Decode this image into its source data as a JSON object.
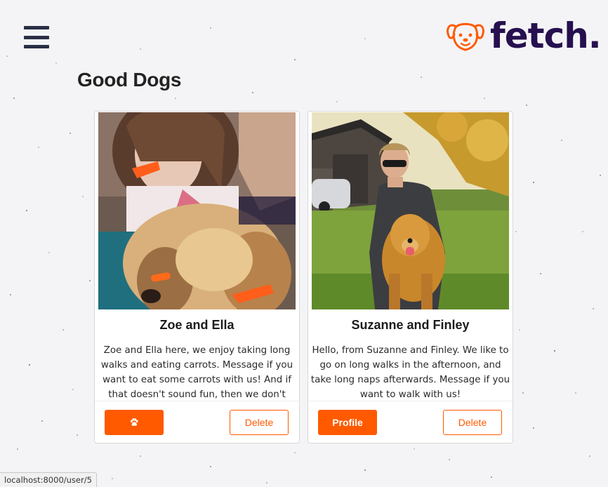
{
  "nav": {
    "menu_icon": "hamburger-menu-icon",
    "logo_icon": "dog-face-icon",
    "logo_text": "fetch."
  },
  "page": {
    "title": "Good Dogs"
  },
  "cards": [
    {
      "name": "Zoe and Ella",
      "description": "Zoe and Ella here, we enjoy taking long walks and eating carrots. Message if you want to eat some carrots with us! And if that doesn't sound fun, then we don't carrot all",
      "primary_button": {
        "label": "",
        "icon": "paw-icon"
      },
      "secondary_button": {
        "label": "Delete"
      }
    },
    {
      "name": "Suzanne and Finley",
      "description": "Hello, from Suzanne and Finley. We like to go on long walks in the afternoon, and take long naps afterwards. Message if you want to walk with us!",
      "primary_button": {
        "label": "Profile"
      },
      "secondary_button": {
        "label": "Delete"
      }
    }
  ],
  "status_bar": {
    "url": "localhost:8000/user/5"
  },
  "colors": {
    "accent": "#ff5a00",
    "brand": "#26104f",
    "menu": "#2b2f45",
    "background": "#f4f4f6"
  }
}
